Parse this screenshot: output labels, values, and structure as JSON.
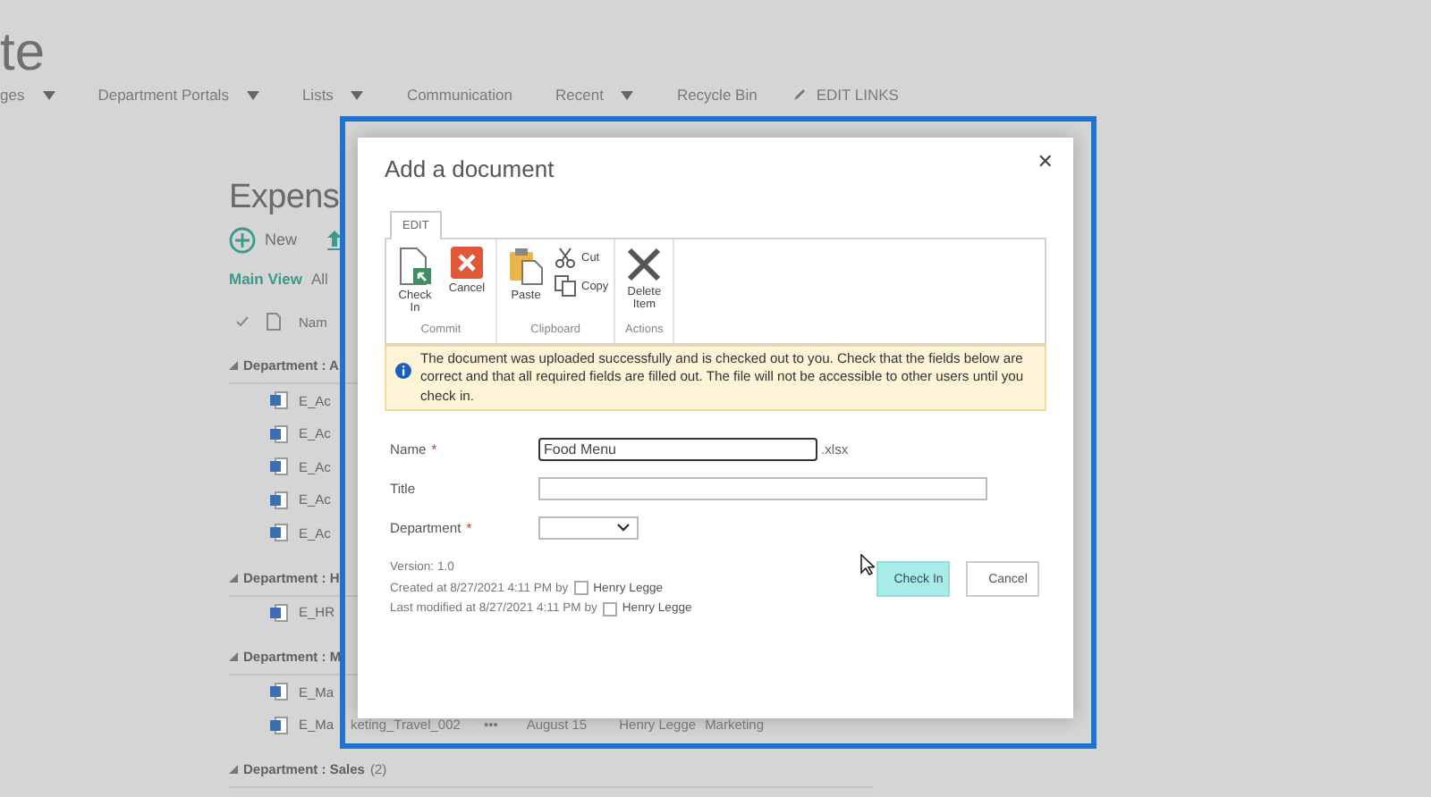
{
  "site_title": "te",
  "nav": [
    {
      "label": "ges",
      "dropdown": true
    },
    {
      "label": "Department Portals",
      "dropdown": true
    },
    {
      "label": "Lists",
      "dropdown": true
    },
    {
      "label": "Communication",
      "dropdown": false
    },
    {
      "label": "Recent",
      "dropdown": true
    },
    {
      "label": "Recycle Bin",
      "dropdown": false
    }
  ],
  "edit_links": "EDIT LINKS",
  "library": {
    "title": "Expens",
    "new_command": "New",
    "views": [
      {
        "label": "Main View",
        "selected": true
      },
      {
        "label": "All",
        "selected": false
      }
    ],
    "name_column": "Nam",
    "groups": [
      {
        "label": "Department : A",
        "items": [
          {
            "name": "E_Ac"
          },
          {
            "name": "E_Ac"
          },
          {
            "name": "E_Ac"
          },
          {
            "name": "E_Ac"
          },
          {
            "name": "E_Ac"
          }
        ]
      },
      {
        "label": "Department : H",
        "items": [
          {
            "name": "E_HR"
          }
        ]
      },
      {
        "label": "Department : M",
        "items": [
          {
            "name": "E_Ma"
          },
          {
            "name": "E_Ma",
            "name_tail": "keting_Travel_002",
            "more": "•••",
            "modified": "August 15",
            "modified_by": "Henry Legge",
            "department": "Marketing"
          }
        ]
      },
      {
        "label": "Department : Sales",
        "count": "(2)"
      }
    ]
  },
  "dialog": {
    "title": "Add a document",
    "close": "✕",
    "ribbon": {
      "tabs": [
        {
          "label": "EDIT",
          "selected": true
        }
      ],
      "groups": [
        {
          "label": "Commit",
          "commands": [
            {
              "kind": "checkin",
              "label": "Check In"
            },
            {
              "kind": "cancel",
              "label": "Cancel"
            }
          ]
        },
        {
          "label": "Clipboard",
          "commands": [
            {
              "kind": "paste",
              "label": "Paste"
            },
            {
              "kind": "cut",
              "label": "Cut"
            },
            {
              "kind": "copy",
              "label": "Copy"
            }
          ]
        },
        {
          "label": "Actions",
          "commands": [
            {
              "kind": "delete",
              "label": "Delete Item"
            }
          ]
        }
      ]
    },
    "message": "The document was uploaded successfully and is checked out to you. Check that the fields below are correct and that all required fields are filled out. The file will not be accessible to other users until you check in.",
    "fields": [
      {
        "kind": "text",
        "label": "Name",
        "required_mark": "*",
        "value": "Food Menu",
        "suffix": ".xlsx",
        "focused": true
      },
      {
        "kind": "text",
        "label": "Title",
        "focused": false
      },
      {
        "kind": "select",
        "label": "Department",
        "required_mark": "*"
      }
    ],
    "version": "Version: 1.0",
    "created": {
      "text": "Created at 8/27/2021 4:11 PM  by",
      "user": "Henry Legge"
    },
    "modified": {
      "text": "Last modified at 8/27/2021 4:11 PM  by",
      "user": "Henry Legge"
    },
    "buttons": [
      {
        "label": "Check In",
        "hovered": true
      },
      {
        "label": "Cancel",
        "hovered": false
      }
    ]
  }
}
